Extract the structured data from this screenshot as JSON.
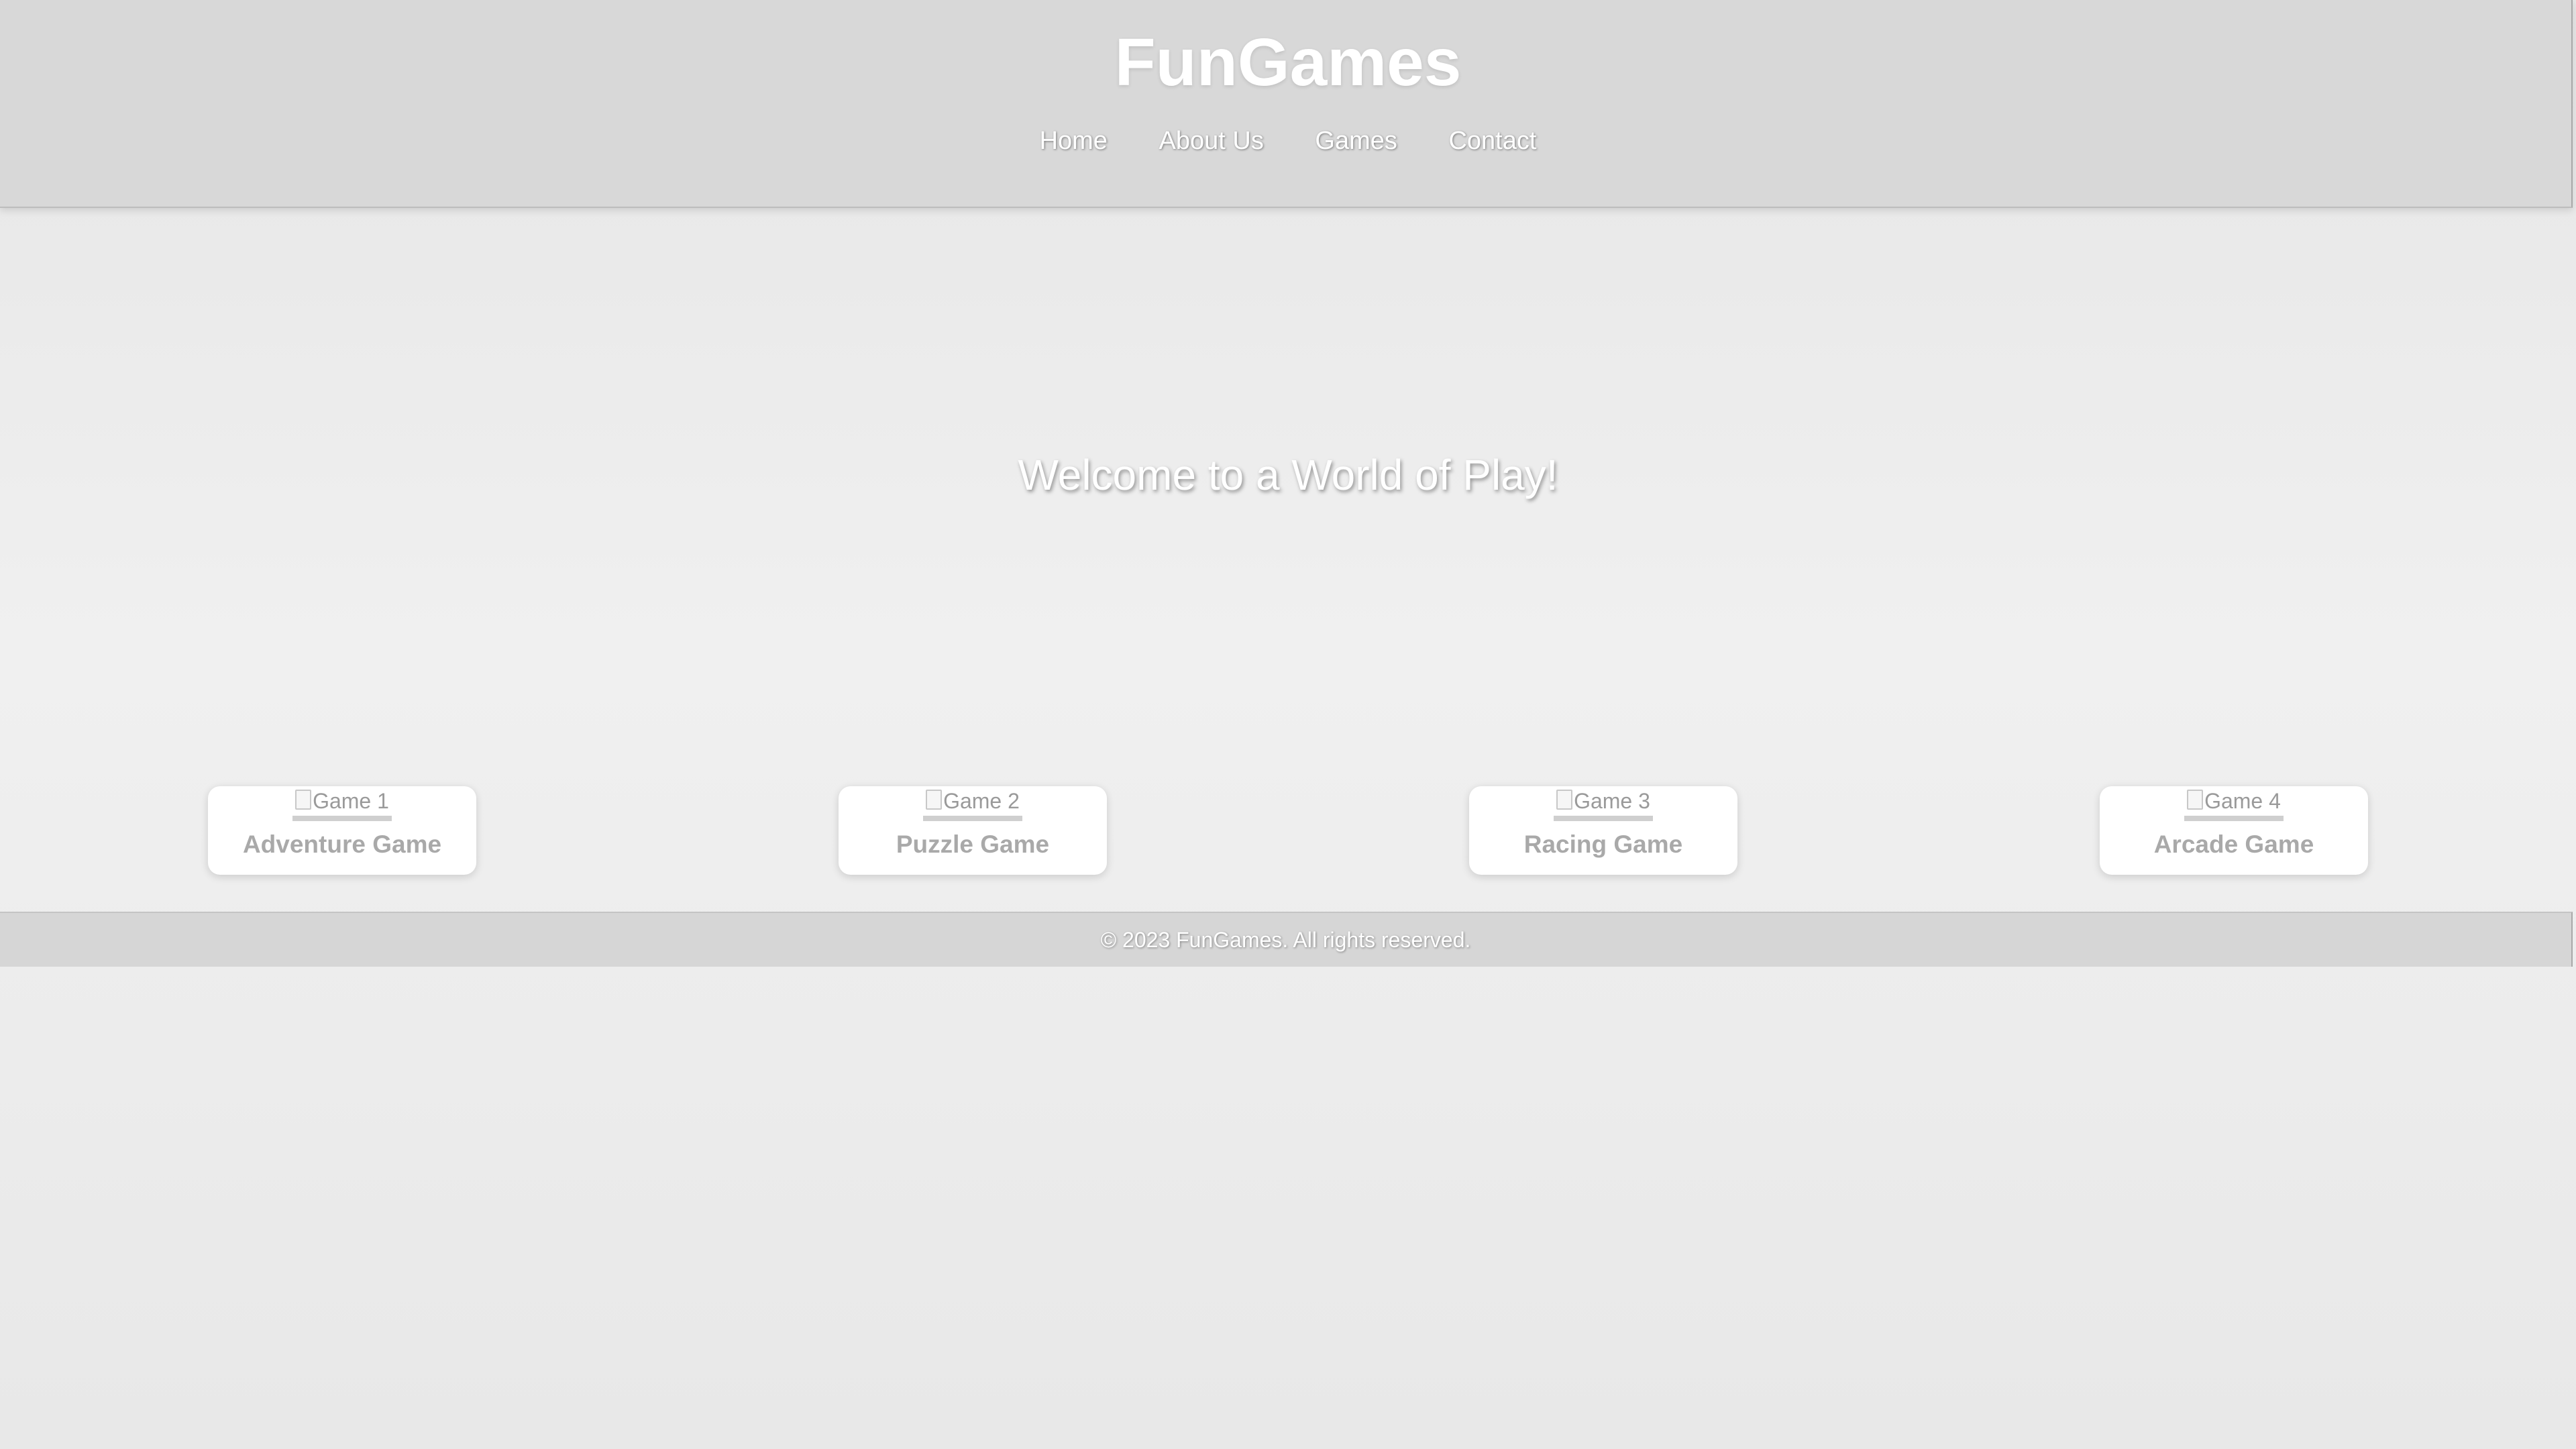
{
  "header": {
    "logo": "FunGames",
    "nav": [
      {
        "label": "Home"
      },
      {
        "label": "About Us"
      },
      {
        "label": "Games"
      },
      {
        "label": "Contact"
      }
    ]
  },
  "hero": {
    "title": "Welcome to a World of Play!"
  },
  "games": [
    {
      "alt": "Game 1",
      "title": "Adventure Game"
    },
    {
      "alt": "Game 2",
      "title": "Puzzle Game"
    },
    {
      "alt": "Game 3",
      "title": "Racing Game"
    },
    {
      "alt": "Game 4",
      "title": "Arcade Game"
    }
  ],
  "footer": {
    "text": "© 2023 FunGames. All rights reserved."
  },
  "colors": {
    "header_bg": "#d8d8d8",
    "footer_bg": "#d6d6d6",
    "card_bg": "#ffffff",
    "text_light": "#ffffff",
    "card_title": "#a9a9a9"
  },
  "icons": {
    "broken_image": "broken-image-icon"
  }
}
